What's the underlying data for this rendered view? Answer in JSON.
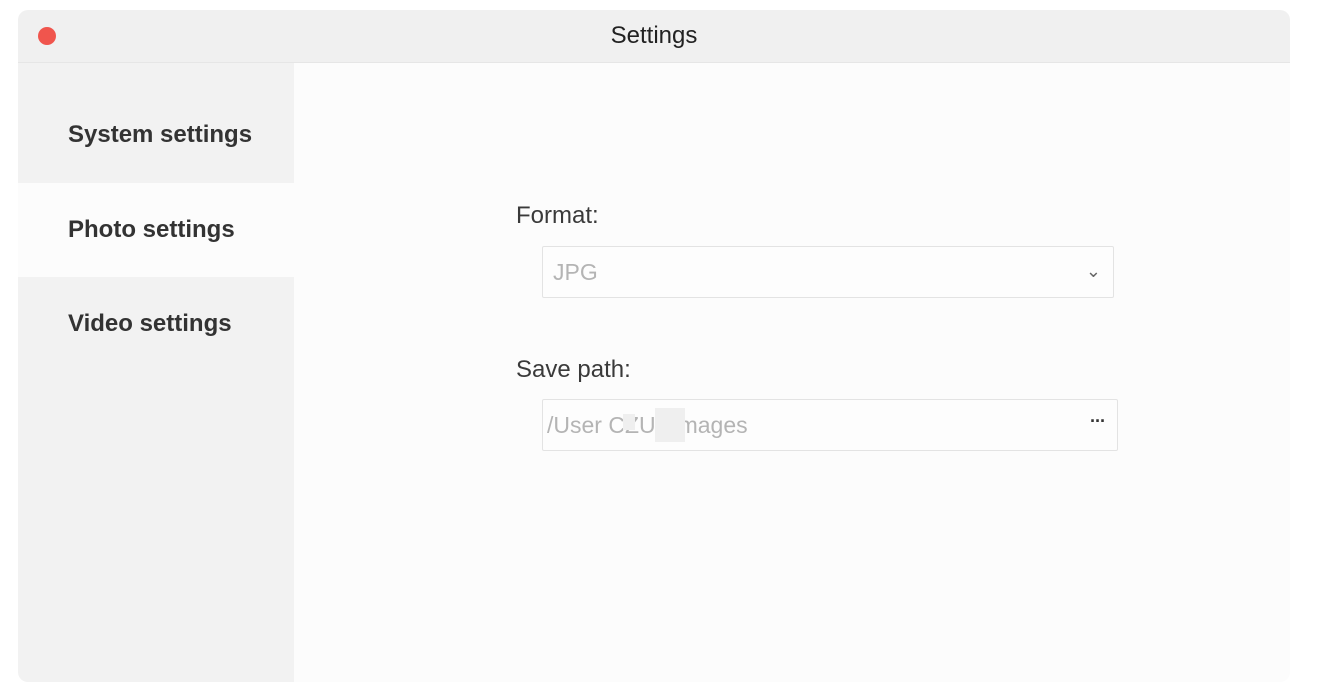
{
  "window": {
    "title": "Settings"
  },
  "sidebar": {
    "items": [
      {
        "label": "System settings",
        "active": false
      },
      {
        "label": "Photo settings",
        "active": true
      },
      {
        "label": "Video settings",
        "active": false
      }
    ]
  },
  "photo_settings": {
    "format_label": "Format:",
    "format_value": "JPG",
    "save_path_label": "Save path:",
    "save_path_value": "/User        CZURImages"
  },
  "icons": {
    "close": "close-dot-icon",
    "dropdown": "chevron-down-icon",
    "browse": "ellipsis-icon"
  },
  "colors": {
    "close_dot": "#f0554d",
    "sidebar_bg": "#f2f2f2",
    "content_bg": "#fcfcfc"
  }
}
